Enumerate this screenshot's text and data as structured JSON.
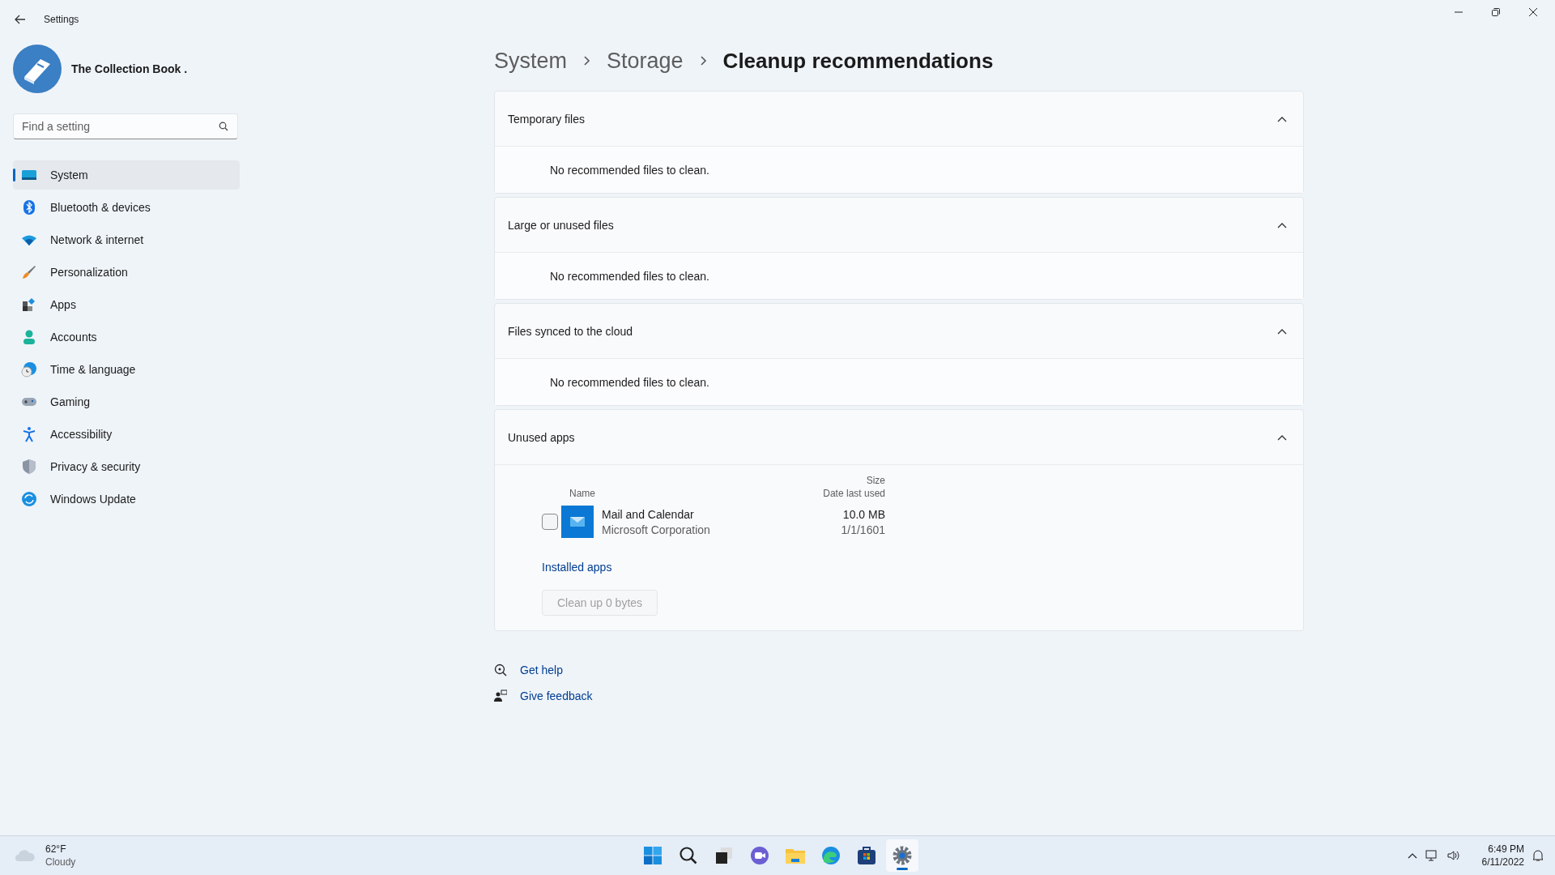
{
  "window": {
    "title": "Settings"
  },
  "profile": {
    "name": "The Collection Book ."
  },
  "search": {
    "placeholder": "Find a setting"
  },
  "nav": [
    {
      "label": "System",
      "kind": "system",
      "selected": true
    },
    {
      "label": "Bluetooth & devices",
      "kind": "bluetooth",
      "selected": false
    },
    {
      "label": "Network & internet",
      "kind": "network",
      "selected": false
    },
    {
      "label": "Personalization",
      "kind": "brush",
      "selected": false
    },
    {
      "label": "Apps",
      "kind": "apps",
      "selected": false
    },
    {
      "label": "Accounts",
      "kind": "accounts",
      "selected": false
    },
    {
      "label": "Time & language",
      "kind": "time",
      "selected": false
    },
    {
      "label": "Gaming",
      "kind": "gaming",
      "selected": false
    },
    {
      "label": "Accessibility",
      "kind": "accessibility",
      "selected": false
    },
    {
      "label": "Privacy & security",
      "kind": "privacy",
      "selected": false
    },
    {
      "label": "Windows Update",
      "kind": "update",
      "selected": false
    }
  ],
  "breadcrumb": [
    "System",
    "Storage",
    "Cleanup recommendations"
  ],
  "sections": [
    {
      "title": "Temporary files",
      "expanded": true,
      "kind": "message",
      "message": "No recommended files to clean."
    },
    {
      "title": "Large or unused files",
      "expanded": true,
      "kind": "message",
      "message": "No recommended files to clean."
    },
    {
      "title": "Files synced to the cloud",
      "expanded": true,
      "kind": "message",
      "message": "No recommended files to clean."
    },
    {
      "title": "Unused apps",
      "expanded": true,
      "kind": "apps",
      "columns": {
        "name": "Name",
        "size": "Size",
        "date": "Date last used"
      },
      "apps": [
        {
          "name": "Mail and Calendar",
          "publisher": "Microsoft Corporation",
          "size": "10.0 MB",
          "date": "1/1/1601",
          "checked": false
        }
      ],
      "link": "Installed apps",
      "button": {
        "label": "Clean up 0 bytes",
        "disabled": true
      }
    }
  ],
  "help_links": [
    {
      "label": "Get help",
      "kind": "help"
    },
    {
      "label": "Give feedback",
      "kind": "feedback"
    }
  ],
  "taskbar": {
    "weather": {
      "temp": "62°F",
      "condition": "Cloudy"
    },
    "apps": [
      {
        "kind": "start",
        "selected": false
      },
      {
        "kind": "search",
        "selected": false
      },
      {
        "kind": "taskview",
        "selected": false
      },
      {
        "kind": "chat",
        "selected": false
      },
      {
        "kind": "folder",
        "selected": false
      },
      {
        "kind": "browser",
        "selected": false
      },
      {
        "kind": "store",
        "selected": false
      },
      {
        "kind": "settings",
        "selected": true
      }
    ],
    "clock": {
      "time": "6:49 PM",
      "date": "6/11/2022"
    }
  }
}
